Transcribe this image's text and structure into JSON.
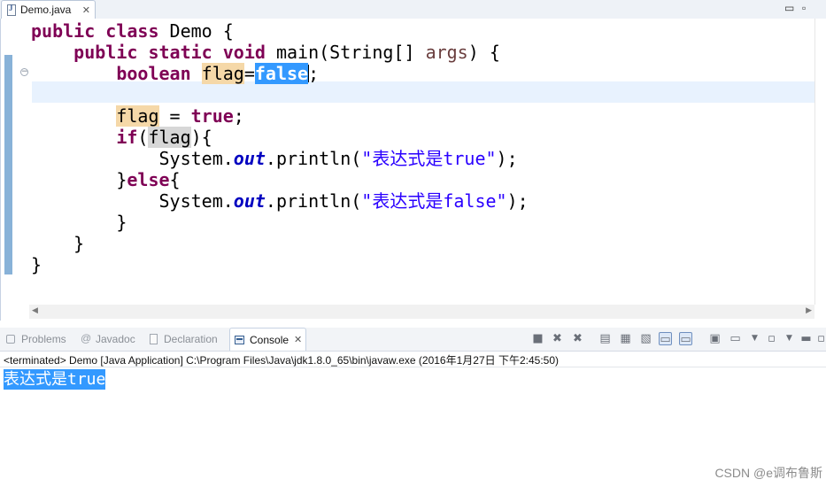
{
  "editor_tab": {
    "filename": "Demo.java",
    "close": "✕"
  },
  "window_controls": {
    "minimize": "▭",
    "maximize": "▫"
  },
  "code": {
    "l1": {
      "kw1": "public",
      "kw2": "class",
      "rest": " Demo {"
    },
    "l2": {
      "kw1": "public",
      "kw2": "static",
      "kw3": "void",
      "mid": " main(String[] ",
      "param": "args",
      "end": ") {"
    },
    "l3": {
      "kw": "boolean",
      "var": "flag",
      "eq": "=",
      "sel": "false",
      "end": ";"
    },
    "l5": {
      "var": "flag",
      "mid": " = ",
      "kw": "true",
      "end": ";"
    },
    "l6": {
      "kw": "if",
      "open": "(",
      "var": "flag",
      "end": "){"
    },
    "l7": {
      "cls": "System.",
      "field": "out",
      "call": ".println(",
      "str": "\"表达式是true\"",
      "end": ");"
    },
    "l8": {
      "open": "}",
      "kw": "else",
      "end": "{"
    },
    "l9": {
      "cls": "System.",
      "field": "out",
      "call": ".println(",
      "str": "\"表达式是false\"",
      "end": ");"
    },
    "l10": "}",
    "l11": "}",
    "l12": "}"
  },
  "views": {
    "tabs": [
      {
        "label": "Problems",
        "icon": "problems-icon",
        "active": false
      },
      {
        "label": "Javadoc",
        "icon": "javadoc-icon",
        "active": false
      },
      {
        "label": "Declaration",
        "icon": "declaration-icon",
        "active": false
      },
      {
        "label": "Console",
        "icon": "console-icon",
        "active": true
      }
    ],
    "console_close": "✕"
  },
  "console": {
    "status": "<terminated> Demo [Java Application] C:\\Program Files\\Java\\jdk1.8.0_65\\bin\\javaw.exe (2016年1月27日 下午2:45:50)",
    "output": "表达式是true"
  },
  "toolbar_icons": [
    "terminate-icon",
    "remove-launch-icon",
    "remove-all-icon",
    "clear-console-icon",
    "scroll-lock-icon",
    "word-wrap-icon",
    "show-on-stdout-icon",
    "show-on-stderr-icon",
    "pin-console-icon",
    "display-console-icon",
    "open-console-icon",
    "minimize-view-icon",
    "maximize-view-icon"
  ],
  "watermark": "CSDN @e调布鲁斯",
  "colors": {
    "keyword": "#7f0055",
    "string": "#2a00ff",
    "selection": "#3399ff",
    "occurrence": "#f5d8a8"
  }
}
